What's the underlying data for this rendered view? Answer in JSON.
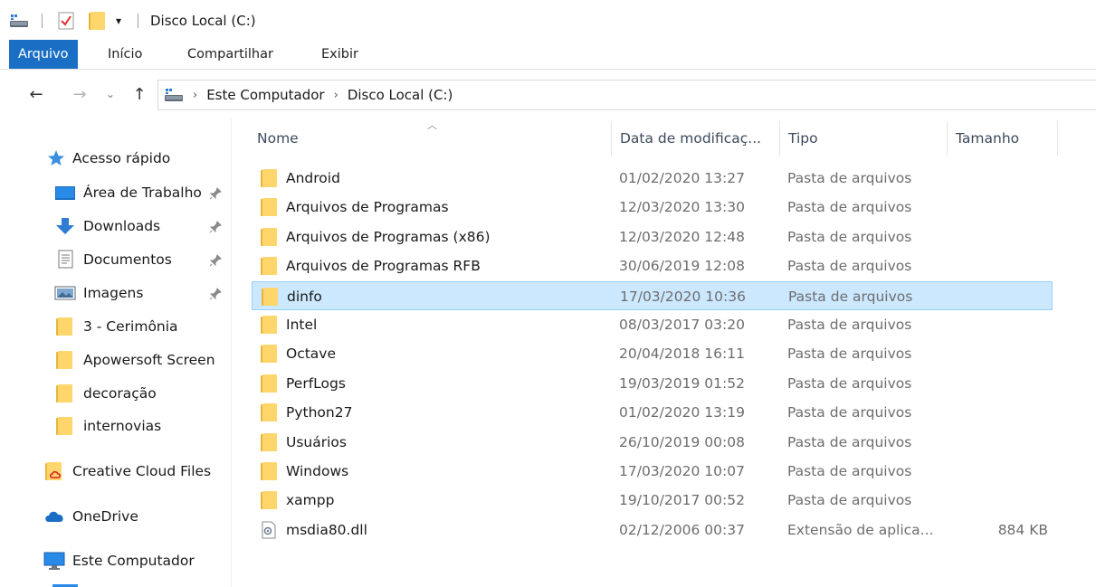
{
  "window": {
    "title": "Disco Local (C:)"
  },
  "ribbon": {
    "tabs": [
      "Arquivo",
      "Início",
      "Compartilhar",
      "Exibir"
    ]
  },
  "address": {
    "crumbs": [
      "Este Computador",
      "Disco Local (C:)"
    ]
  },
  "nav": {
    "quick_access": "Acesso rápido",
    "items": [
      {
        "label": "Área de Trabalho",
        "icon": "desktop-icon",
        "pinned": true
      },
      {
        "label": "Downloads",
        "icon": "download-arrow-icon",
        "pinned": true
      },
      {
        "label": "Documentos",
        "icon": "document-icon",
        "pinned": true
      },
      {
        "label": "Imagens",
        "icon": "pictures-icon",
        "pinned": true
      },
      {
        "label": "3 - Cerimônia",
        "icon": "folder-icon",
        "pinned": false
      },
      {
        "label": "Apowersoft Screen",
        "icon": "folder-icon",
        "pinned": false
      },
      {
        "label": "decoração",
        "icon": "folder-icon",
        "pinned": false
      },
      {
        "label": "internovias",
        "icon": "folder-icon",
        "pinned": false
      }
    ],
    "creative_cloud": "Creative Cloud Files",
    "onedrive": "OneDrive",
    "this_pc": "Este Computador"
  },
  "columns": {
    "name": "Nome",
    "date": "Data de modificaç...",
    "type": "Tipo",
    "size": "Tamanho"
  },
  "files": [
    {
      "name": "Android",
      "date": "01/02/2020 13:27",
      "type": "Pasta de arquivos",
      "size": "",
      "kind": "folder"
    },
    {
      "name": "Arquivos de Programas",
      "date": "12/03/2020 13:30",
      "type": "Pasta de arquivos",
      "size": "",
      "kind": "folder"
    },
    {
      "name": "Arquivos de Programas (x86)",
      "date": "12/03/2020 12:48",
      "type": "Pasta de arquivos",
      "size": "",
      "kind": "folder"
    },
    {
      "name": "Arquivos de Programas RFB",
      "date": "30/06/2019 12:08",
      "type": "Pasta de arquivos",
      "size": "",
      "kind": "folder"
    },
    {
      "name": "dinfo",
      "date": "17/03/2020 10:36",
      "type": "Pasta de arquivos",
      "size": "",
      "kind": "folder",
      "selected": true
    },
    {
      "name": "Intel",
      "date": "08/03/2017 03:20",
      "type": "Pasta de arquivos",
      "size": "",
      "kind": "folder"
    },
    {
      "name": "Octave",
      "date": "20/04/2018 16:11",
      "type": "Pasta de arquivos",
      "size": "",
      "kind": "folder"
    },
    {
      "name": "PerfLogs",
      "date": "19/03/2019 01:52",
      "type": "Pasta de arquivos",
      "size": "",
      "kind": "folder"
    },
    {
      "name": "Python27",
      "date": "01/02/2020 13:19",
      "type": "Pasta de arquivos",
      "size": "",
      "kind": "folder"
    },
    {
      "name": "Usuários",
      "date": "26/10/2019 00:08",
      "type": "Pasta de arquivos",
      "size": "",
      "kind": "folder"
    },
    {
      "name": "Windows",
      "date": "17/03/2020 10:07",
      "type": "Pasta de arquivos",
      "size": "",
      "kind": "folder"
    },
    {
      "name": "xampp",
      "date": "19/10/2017 00:52",
      "type": "Pasta de arquivos",
      "size": "",
      "kind": "folder"
    },
    {
      "name": "msdia80.dll",
      "date": "02/12/2006 00:37",
      "type": "Extensão de aplica...",
      "size": "884 KB",
      "kind": "dll"
    }
  ],
  "colors": {
    "accent": "#1a6fc4",
    "selection": "#cce8ff",
    "selection_border": "#99d1ff",
    "folder": "#ffd66b"
  }
}
